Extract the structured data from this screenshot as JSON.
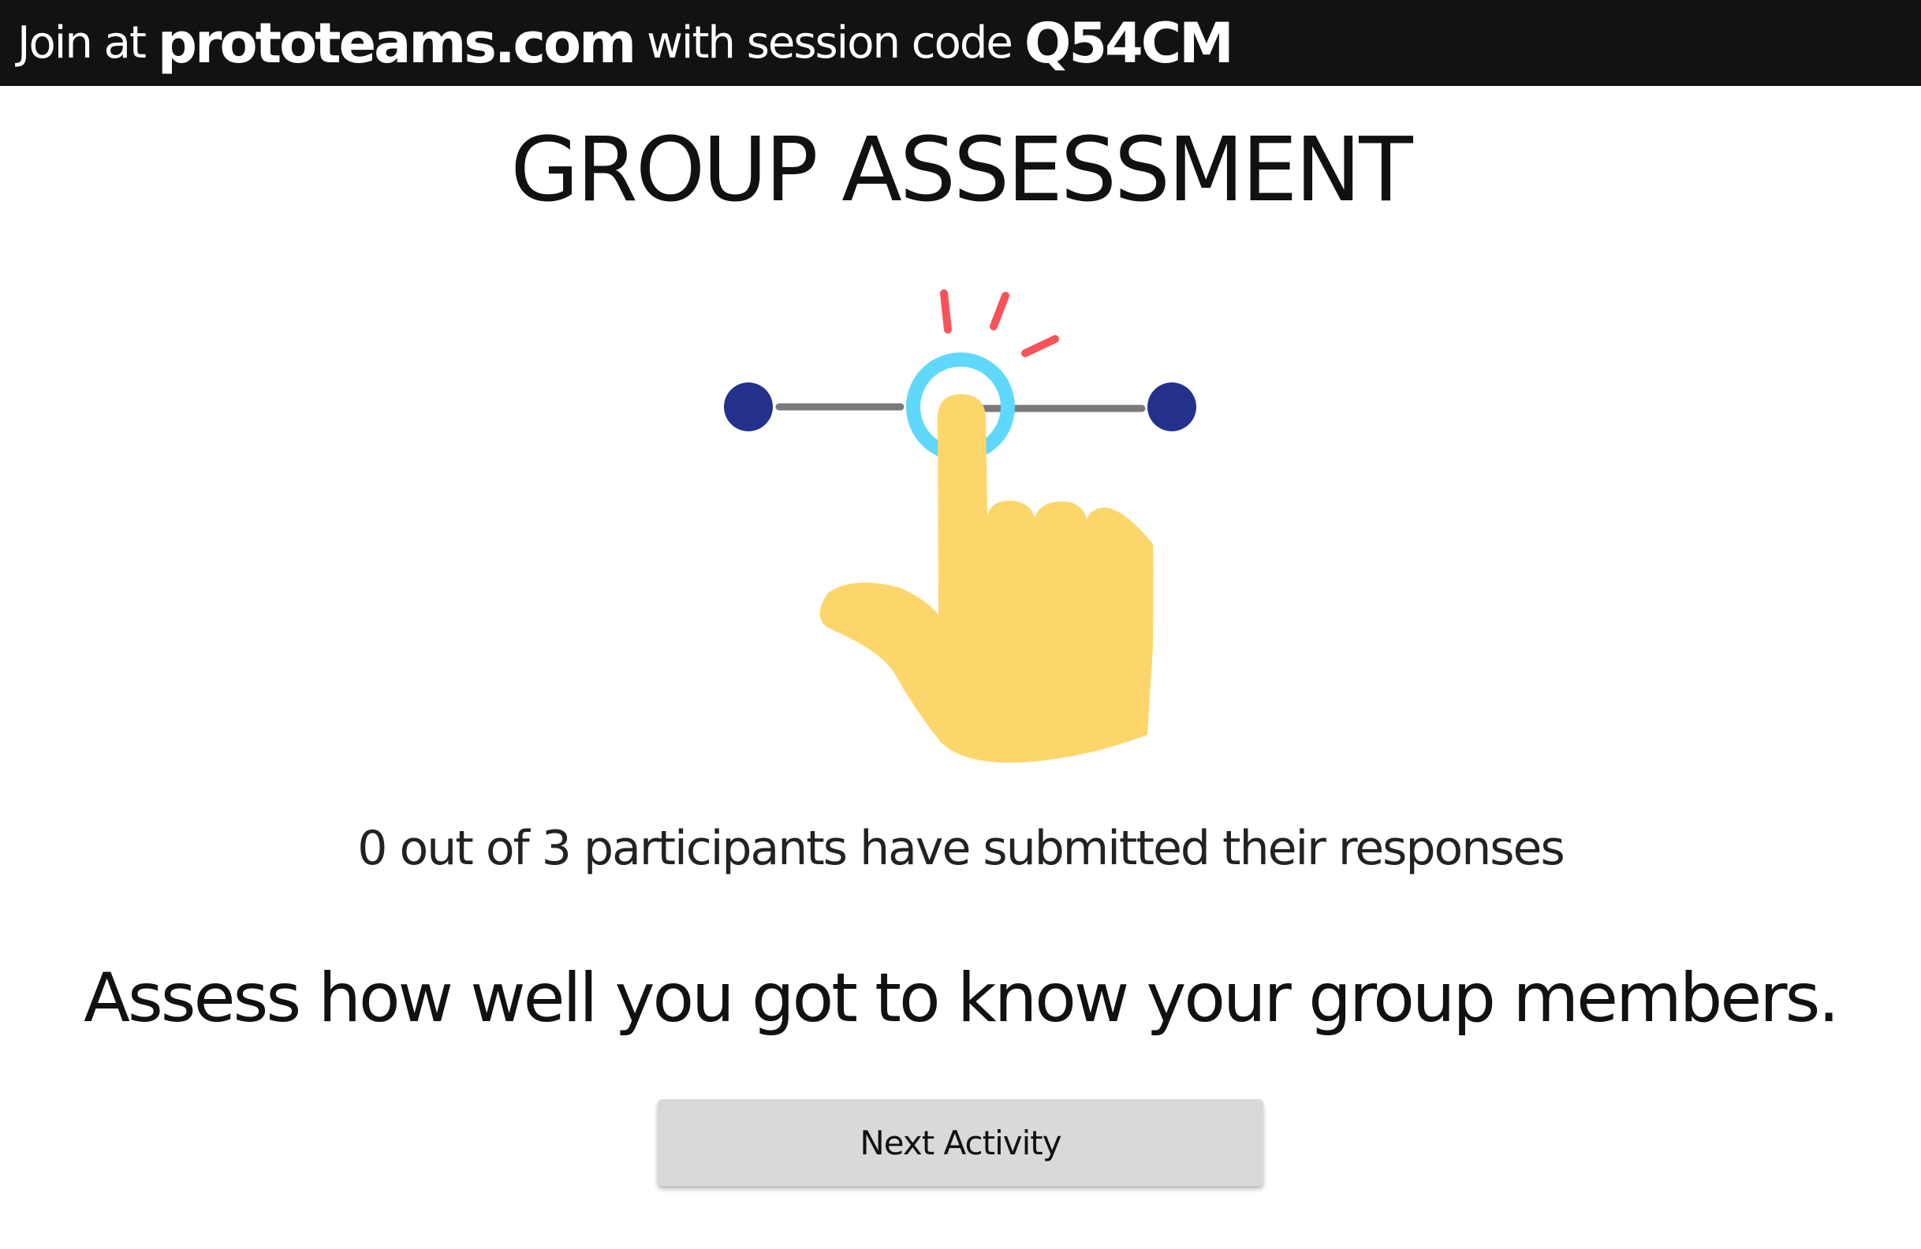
{
  "header": {
    "join_prefix": "Join at",
    "site": "prototeams.com",
    "session_text": "with session code",
    "session_code": "Q54CM"
  },
  "page": {
    "title": "GROUP ASSESSMENT"
  },
  "illustration": {
    "icon": "hand-tapping-slider-icon",
    "colors": {
      "endpoint": "#24318c",
      "track": "#7a7a7a",
      "ring": "#5fd8fb",
      "sparks": "#f7545a",
      "hand": "#fdd66b"
    }
  },
  "status": {
    "text": "0 out of 3 participants have submitted their responses"
  },
  "prompt": {
    "text": "Assess how well you got to know your group members."
  },
  "actions": {
    "next_label": "Next Activity"
  }
}
